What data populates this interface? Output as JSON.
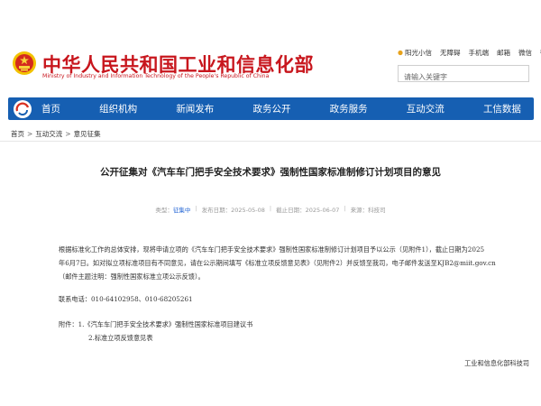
{
  "header": {
    "title": "中华人民共和国工业和信息化部",
    "subtitle": "Ministry of Industry and Information Technology of the People's Republic of China",
    "emblem_icon": "national-emblem-icon",
    "brand_color": "#c8161d"
  },
  "util_links": [
    {
      "label": "阳光小信",
      "icon": "sun-icon"
    },
    {
      "label": "无障碍",
      "icon": ""
    },
    {
      "label": "手机端",
      "icon": ""
    },
    {
      "label": "邮箱",
      "icon": ""
    },
    {
      "label": "微信",
      "icon": ""
    },
    {
      "label": "微博",
      "icon": ""
    }
  ],
  "search": {
    "placeholder": "请输入关键字"
  },
  "nav": {
    "color": "#165fb2",
    "logo_icon": "miit-logo-icon",
    "items": [
      "首页",
      "组织机构",
      "新闻发布",
      "政务公开",
      "政务服务",
      "互动交流",
      "工信数据"
    ]
  },
  "breadcrumb": [
    "首页",
    "互动交流",
    "意见征集"
  ],
  "article": {
    "title": "公开征集对《汽车车门把手安全技术要求》强制性国家标准制修订计划项目的意见",
    "meta": {
      "type_label": "征集中",
      "publish_label": "发布日期：",
      "publish_date": "2025-05-08",
      "deadline_label": "截止日期：",
      "deadline_date": "2025-06-07",
      "source_label": "来源：",
      "source_value": "科技司"
    },
    "paragraph_lines": [
      "根据标准化工作的总体安排，现将申请立项的《汽车车门把手安全技术要求》强制性国家标准制修订计划项目予以公示（见附件1），截止日期为2025",
      "年6月7日。如对拟立项标准项目有不同意见，请在公示期间填写《标准立项反馈意见表》（见附件2）并反馈至我司，电子邮件发送至",
      "（邮件主题注明：强制性国家标准立项公示反馈）。"
    ],
    "email": "KJB2@miit.gov.cn",
    "contact": "联系电话：010-64102958、010-68205261",
    "attachments": [
      "附件：1.《汽车车门把手安全技术要求》强制性国家标准项目建议书",
      "2.标准立项反馈意见表"
    ],
    "signature": "工业和信息化部科技司"
  }
}
